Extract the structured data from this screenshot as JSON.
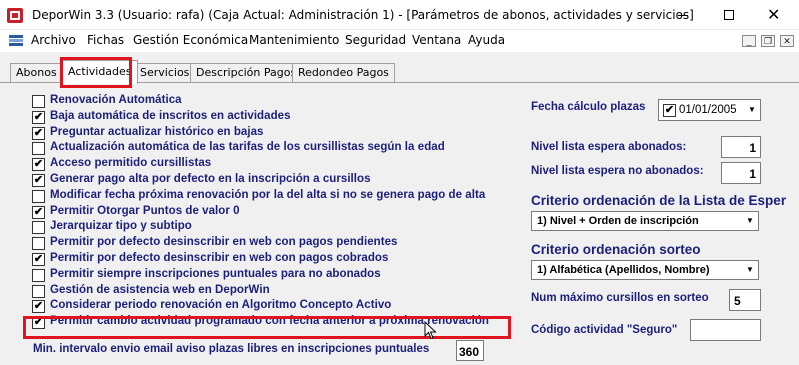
{
  "window": {
    "title": "DeporWin 3.3  (Usuario: rafa)  (Caja Actual: Administración 1) - [Parámetros de abonos, actividades y servicios]",
    "minimize_icon": "minimize-icon",
    "maximize_icon": "maximize-icon",
    "close_icon": "close-icon",
    "close_glyph": "✕"
  },
  "menu": {
    "items": [
      "Archivo",
      "Fichas",
      "Gestión Económica",
      "Mantenimiento",
      "Seguridad",
      "Ventana",
      "Ayuda"
    ],
    "mdi_minimize": "_",
    "mdi_restore": "❐",
    "mdi_close": "✕"
  },
  "tabs": [
    "Abonos",
    "Actividades",
    "Servicios",
    "Descripción Pagos",
    "Redondeo Pagos"
  ],
  "active_tab": "Actividades",
  "options": [
    {
      "label": "Renovación Automática",
      "checked": false
    },
    {
      "label": "Baja automática de inscritos en actividades",
      "checked": true
    },
    {
      "label": "Preguntar actualizar histórico en bajas",
      "checked": true
    },
    {
      "label": "Actualización automática de las tarifas de los cursillistas según la edad",
      "checked": false
    },
    {
      "label": "Acceso permitido cursillistas",
      "checked": true
    },
    {
      "label": "Generar pago alta por defecto en la inscripción a cursillos",
      "checked": true
    },
    {
      "label": "Modificar fecha próxima renovación por la del alta si no se genera pago de alta",
      "checked": false
    },
    {
      "label": "Permitir Otorgar Puntos de valor 0",
      "checked": true
    },
    {
      "label": "Jerarquizar tipo y subtipo",
      "checked": false
    },
    {
      "label": "Permitir por defecto desinscribir en web con pagos pendientes",
      "checked": false
    },
    {
      "label": "Permitir por defecto desinscribir en web con pagos cobrados",
      "checked": true
    },
    {
      "label": "Permitir siempre inscripciones puntuales para no abonados",
      "checked": false
    },
    {
      "label": "Gestión de asistencia web en DeporWin",
      "checked": false
    },
    {
      "label": "Considerar periodo renovación en Algoritmo Concepto Activo",
      "checked": true
    },
    {
      "label": "Permitir cambio actividad programado con fecha anterior a próxima renovación",
      "checked": true
    }
  ],
  "check_glyph": "✔",
  "min_interval": {
    "label": "Min. intervalo envio email aviso plazas libres en inscripciones puntuales",
    "value": "360"
  },
  "right": {
    "fecha_label": "Fecha cálculo plazas",
    "fecha_checked": true,
    "fecha_value": "01/01/2005",
    "nivel_abonados_label": "Nivel lista espera abonados:",
    "nivel_abonados_value": "1",
    "nivel_no_abonados_label": "Nivel lista espera no abonados:",
    "nivel_no_abonados_value": "1",
    "criterio_lista_heading": "Criterio ordenación de la Lista de Esper",
    "criterio_lista_value": "1) Nivel + Orden de inscripción",
    "criterio_sorteo_heading": "Criterio ordenación sorteo",
    "criterio_sorteo_value": "1) Alfabética (Apellidos, Nombre)",
    "num_max_label": "Num máximo cursillos en sorteo",
    "num_max_value": "5",
    "codigo_label": "Código actividad \"Seguro\"",
    "codigo_value": "",
    "dropdown_glyph": "▼"
  }
}
